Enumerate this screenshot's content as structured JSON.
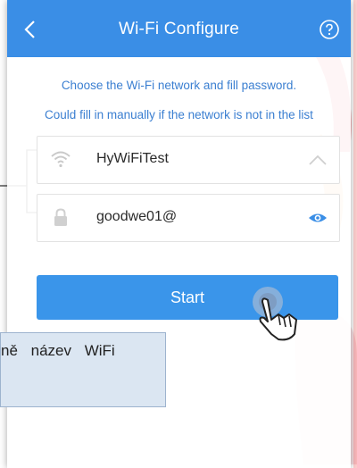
{
  "header": {
    "title": "Wi-Fi Configure",
    "back_icon": "chevron-left-icon",
    "help_icon": "question-circle-icon",
    "color": "#3a8ee6"
  },
  "instructions": {
    "line1": "Choose the Wi-Fi network and fill password.",
    "line2": "Could fill in manually if the network is not in the list"
  },
  "network_field": {
    "value": "HyWiFiTest",
    "leading_icon": "wifi-icon",
    "trailing_icon": "chevron-up-icon"
  },
  "password_field": {
    "value": "goodwe01@",
    "leading_icon": "lock-icon",
    "trailing_icon": "eye-icon"
  },
  "start_button": {
    "label": "Start",
    "color": "#3a95ea"
  },
  "caption": {
    "text": "ně název WiFi"
  },
  "accent_colors": {
    "brand_red": "#e8232c",
    "accent_orange": "#f7931e"
  }
}
